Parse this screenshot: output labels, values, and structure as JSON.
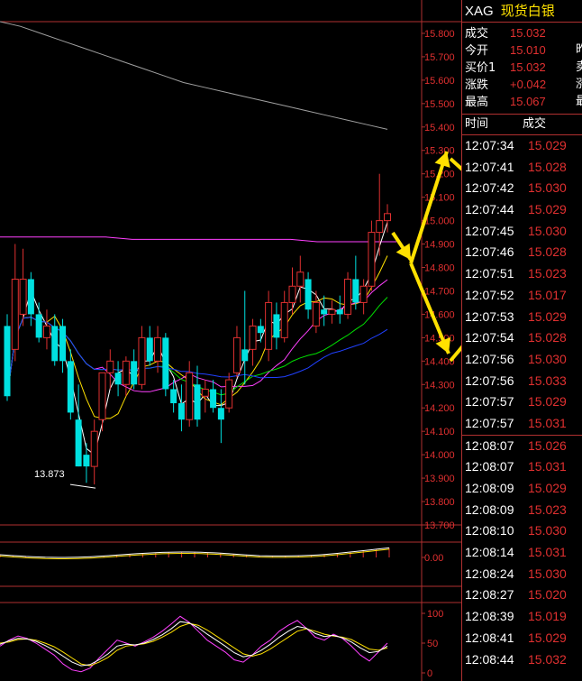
{
  "quote": {
    "symbol": "XAG",
    "name": "现货白银",
    "rows": [
      {
        "label": "成交",
        "value": "15.032",
        "cut": ""
      },
      {
        "label": "今开",
        "value": "15.010",
        "cut": "昨"
      },
      {
        "label": "买价1",
        "value": "15.032",
        "cut": "卖"
      },
      {
        "label": "涨跌",
        "value": "+0.042",
        "cut": "涨"
      },
      {
        "label": "最高",
        "value": "15.067",
        "cut": "最"
      }
    ]
  },
  "ticks": {
    "header_time": "时间",
    "header_price": "成交",
    "rows": [
      {
        "time": "12:07:34",
        "price": "15.029"
      },
      {
        "time": "12:07:41",
        "price": "15.028"
      },
      {
        "time": "12:07:42",
        "price": "15.030"
      },
      {
        "time": "12:07:44",
        "price": "15.029"
      },
      {
        "time": "12:07:45",
        "price": "15.030"
      },
      {
        "time": "12:07:46",
        "price": "15.028"
      },
      {
        "time": "12:07:51",
        "price": "15.023"
      },
      {
        "time": "12:07:52",
        "price": "15.017"
      },
      {
        "time": "12:07:53",
        "price": "15.029"
      },
      {
        "time": "12:07:54",
        "price": "15.028"
      },
      {
        "time": "12:07:56",
        "price": "15.030"
      },
      {
        "time": "12:07:56",
        "price": "15.033"
      },
      {
        "time": "12:07:57",
        "price": "15.029"
      },
      {
        "time": "12:07:57",
        "price": "15.031"
      },
      {
        "time": "12:08:07",
        "price": "15.026"
      },
      {
        "time": "12:08:07",
        "price": "15.031"
      },
      {
        "time": "12:08:09",
        "price": "15.029"
      },
      {
        "time": "12:08:09",
        "price": "15.023"
      },
      {
        "time": "12:08:10",
        "price": "15.030"
      },
      {
        "time": "12:08:14",
        "price": "15.031"
      },
      {
        "time": "12:08:24",
        "price": "15.030"
      },
      {
        "time": "12:08:27",
        "price": "15.020"
      },
      {
        "time": "12:08:39",
        "price": "15.019"
      },
      {
        "time": "12:08:41",
        "price": "15.029"
      },
      {
        "time": "12:08:44",
        "price": "15.032"
      }
    ]
  },
  "chart_data": [
    {
      "type": "candlestick",
      "title": "",
      "ylim": [
        13.7,
        15.85
      ],
      "y_ticks": [
        "15.800",
        "15.700",
        "15.600",
        "15.500",
        "15.400",
        "15.300",
        "15.200",
        "15.100",
        "15.000",
        "14.900",
        "14.800",
        "14.700",
        "14.600",
        "14.500",
        "14.400",
        "14.300",
        "14.200",
        "14.100",
        "14.000",
        "13.900",
        "13.800",
        "13.700"
      ],
      "annotation_low": "13.873",
      "candles": [
        {
          "o": 14.55,
          "h": 14.6,
          "l": 14.23,
          "c": 14.25
        },
        {
          "o": 14.45,
          "h": 14.9,
          "l": 14.4,
          "c": 14.75
        },
        {
          "o": 14.6,
          "h": 14.88,
          "l": 14.55,
          "c": 14.75
        },
        {
          "o": 14.75,
          "h": 14.78,
          "l": 14.55,
          "c": 14.6
        },
        {
          "o": 14.6,
          "h": 14.65,
          "l": 14.48,
          "c": 14.5
        },
        {
          "o": 14.5,
          "h": 14.62,
          "l": 14.45,
          "c": 14.55
        },
        {
          "o": 14.55,
          "h": 14.6,
          "l": 14.38,
          "c": 14.4
        },
        {
          "o": 14.55,
          "h": 14.58,
          "l": 14.35,
          "c": 14.4
        },
        {
          "o": 14.4,
          "h": 14.45,
          "l": 14.15,
          "c": 14.18
        },
        {
          "o": 14.15,
          "h": 14.3,
          "l": 13.95,
          "c": 13.95
        },
        {
          "o": 14.0,
          "h": 14.05,
          "l": 13.88,
          "c": 13.95
        },
        {
          "o": 13.95,
          "h": 14.15,
          "l": 13.873,
          "c": 14.1
        },
        {
          "o": 14.15,
          "h": 14.35,
          "l": 14.1,
          "c": 14.35
        },
        {
          "o": 14.35,
          "h": 14.45,
          "l": 14.28,
          "c": 14.4
        },
        {
          "o": 14.35,
          "h": 14.4,
          "l": 14.25,
          "c": 14.3
        },
        {
          "o": 14.3,
          "h": 14.42,
          "l": 14.25,
          "c": 14.4
        },
        {
          "o": 14.4,
          "h": 14.45,
          "l": 14.28,
          "c": 14.3
        },
        {
          "o": 14.3,
          "h": 14.55,
          "l": 14.28,
          "c": 14.5
        },
        {
          "o": 14.5,
          "h": 14.55,
          "l": 14.38,
          "c": 14.4
        },
        {
          "o": 14.4,
          "h": 14.55,
          "l": 14.35,
          "c": 14.5
        },
        {
          "o": 14.5,
          "h": 14.52,
          "l": 14.25,
          "c": 14.28
        },
        {
          "o": 14.28,
          "h": 14.32,
          "l": 14.18,
          "c": 14.22
        },
        {
          "o": 14.22,
          "h": 14.3,
          "l": 14.1,
          "c": 14.15
        },
        {
          "o": 14.15,
          "h": 14.4,
          "l": 14.12,
          "c": 14.35
        },
        {
          "o": 14.3,
          "h": 14.38,
          "l": 14.12,
          "c": 14.15
        },
        {
          "o": 14.25,
          "h": 14.32,
          "l": 14.18,
          "c": 14.28
        },
        {
          "o": 14.28,
          "h": 14.32,
          "l": 14.18,
          "c": 14.2
        },
        {
          "o": 14.2,
          "h": 14.28,
          "l": 14.05,
          "c": 14.15
        },
        {
          "o": 14.2,
          "h": 14.35,
          "l": 14.18,
          "c": 14.32
        },
        {
          "o": 14.35,
          "h": 14.55,
          "l": 14.33,
          "c": 14.5
        },
        {
          "o": 14.45,
          "h": 14.7,
          "l": 14.3,
          "c": 14.4
        },
        {
          "o": 14.45,
          "h": 14.58,
          "l": 14.38,
          "c": 14.55
        },
        {
          "o": 14.55,
          "h": 14.58,
          "l": 14.48,
          "c": 14.52
        },
        {
          "o": 14.45,
          "h": 14.7,
          "l": 14.4,
          "c": 14.65
        },
        {
          "o": 14.6,
          "h": 14.65,
          "l": 14.45,
          "c": 14.5
        },
        {
          "o": 14.5,
          "h": 14.7,
          "l": 14.48,
          "c": 14.65
        },
        {
          "o": 14.65,
          "h": 14.8,
          "l": 14.6,
          "c": 14.72
        },
        {
          "o": 14.72,
          "h": 14.85,
          "l": 14.65,
          "c": 14.78
        },
        {
          "o": 14.75,
          "h": 14.78,
          "l": 14.58,
          "c": 14.62
        },
        {
          "o": 14.55,
          "h": 14.7,
          "l": 14.52,
          "c": 14.65
        },
        {
          "o": 14.62,
          "h": 14.68,
          "l": 14.55,
          "c": 14.6
        },
        {
          "o": 14.6,
          "h": 14.66,
          "l": 14.56,
          "c": 14.62
        },
        {
          "o": 14.62,
          "h": 14.68,
          "l": 14.56,
          "c": 14.6
        },
        {
          "o": 14.6,
          "h": 14.78,
          "l": 14.58,
          "c": 14.75
        },
        {
          "o": 14.75,
          "h": 14.85,
          "l": 14.62,
          "c": 14.65
        },
        {
          "o": 14.65,
          "h": 14.75,
          "l": 14.6,
          "c": 14.72
        },
        {
          "o": 14.72,
          "h": 15.0,
          "l": 14.7,
          "c": 14.95
        },
        {
          "o": 14.95,
          "h": 15.2,
          "l": 14.85,
          "c": 15.0
        },
        {
          "o": 15.0,
          "h": 15.07,
          "l": 14.95,
          "c": 15.03
        }
      ],
      "bull_color": "#e03030",
      "bear_color": "#00e0e0",
      "ma_lines": [
        {
          "color": "#a0a0a0",
          "values": [
            15.85,
            15.83,
            15.8,
            15.77,
            15.74,
            15.71,
            15.68,
            15.65,
            15.62,
            15.59,
            15.57,
            15.55,
            15.53,
            15.51,
            15.49,
            15.47,
            15.45,
            15.43,
            15.41,
            15.39
          ]
        },
        {
          "color": "#ff40ff",
          "values": [
            14.93,
            14.93,
            14.93,
            14.93,
            14.93,
            14.92,
            14.92,
            14.92,
            14.92,
            14.92,
            14.92,
            14.92,
            14.91,
            14.91,
            14.91,
            14.91
          ]
        }
      ]
    },
    {
      "type": "bar",
      "title": "",
      "y_ticks": [
        "0.00"
      ]
    },
    {
      "type": "line",
      "title": "",
      "y_ticks": [
        "100",
        "50",
        "0"
      ]
    }
  ]
}
